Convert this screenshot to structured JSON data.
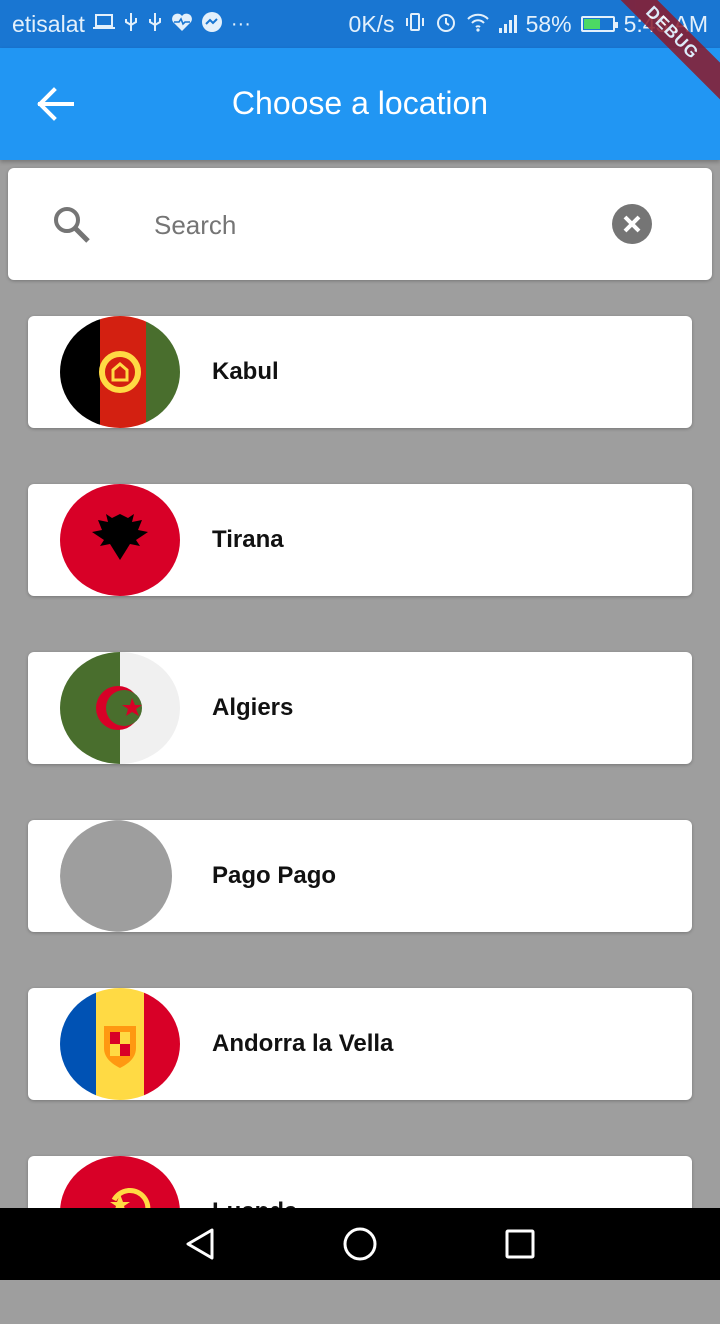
{
  "status_bar": {
    "carrier": "etisalat",
    "speed": "0K/s",
    "battery_percent": "58%",
    "battery_level": 0.58,
    "time": "5:43 AM",
    "icons": [
      "laptop-icon",
      "usb-icon",
      "usb-icon",
      "heart-rate-icon",
      "messenger-icon",
      "more-icon",
      "vibrate-icon",
      "alarm-icon",
      "wifi-icon",
      "signal-icon",
      "battery-charging-icon"
    ]
  },
  "debug_banner": "DEBUG",
  "app_bar": {
    "title": "Choose a location",
    "back_icon": "arrow-back-icon",
    "color": "#2196f3"
  },
  "search": {
    "placeholder": "Search",
    "value": "",
    "search_icon": "search-icon",
    "clear_icon": "clear-circle-icon"
  },
  "locations": [
    {
      "label": "Kabul",
      "flag": "afghanistan-flag-icon"
    },
    {
      "label": "Tirana",
      "flag": "albania-flag-icon"
    },
    {
      "label": "Algiers",
      "flag": "algeria-flag-icon"
    },
    {
      "label": "Pago Pago",
      "flag": "placeholder-flag-icon"
    },
    {
      "label": "Andorra la Vella",
      "flag": "andorra-flag-icon"
    },
    {
      "label": "Luanda",
      "flag": "angola-flag-icon"
    }
  ],
  "nav_bar": {
    "buttons": [
      "back-triangle-icon",
      "home-circle-icon",
      "recents-square-icon"
    ]
  }
}
